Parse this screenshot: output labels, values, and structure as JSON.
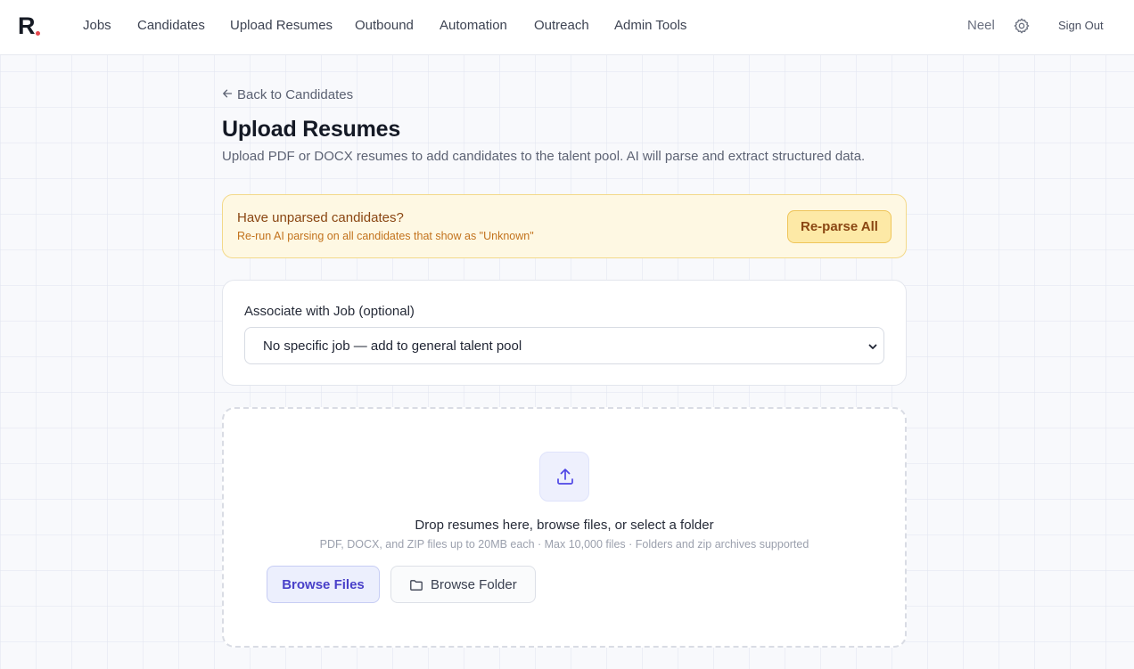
{
  "brand": {
    "logo_letter": "R",
    "accent": "#e5484d"
  },
  "nav": {
    "items": [
      {
        "label": "Jobs"
      },
      {
        "label": "Candidates"
      },
      {
        "label": "Upload Resumes"
      },
      {
        "label": "Outbound"
      },
      {
        "label": "Automation"
      },
      {
        "label": "Outreach"
      },
      {
        "label": "Admin Tools"
      }
    ],
    "user": "Neel",
    "settings_icon": "gear-icon",
    "sign_out": "Sign Out"
  },
  "page": {
    "back_label": "Back to Candidates",
    "title": "Upload Resumes",
    "subtitle": "Upload PDF or DOCX resumes to add candidates to the talent pool. AI will parse and extract structured data."
  },
  "banner": {
    "title": "Have unparsed candidates?",
    "text": "Re-run AI parsing on all candidates that show as \"Unknown\"",
    "button": "Re-parse All",
    "color": "#fef8e3"
  },
  "job_select": {
    "label": "Associate with Job (optional)",
    "selected": "No specific job — add to general talent pool"
  },
  "dropzone": {
    "title": "Drop resumes here, browse files, or select a folder",
    "hint": "PDF, DOCX, and ZIP files up to 20MB each · Max 10,000 files · Folders and zip archives supported",
    "browse_files": "Browse Files",
    "browse_folder": "Browse Folder",
    "icon": "upload-icon",
    "accent": "#4940c9"
  }
}
